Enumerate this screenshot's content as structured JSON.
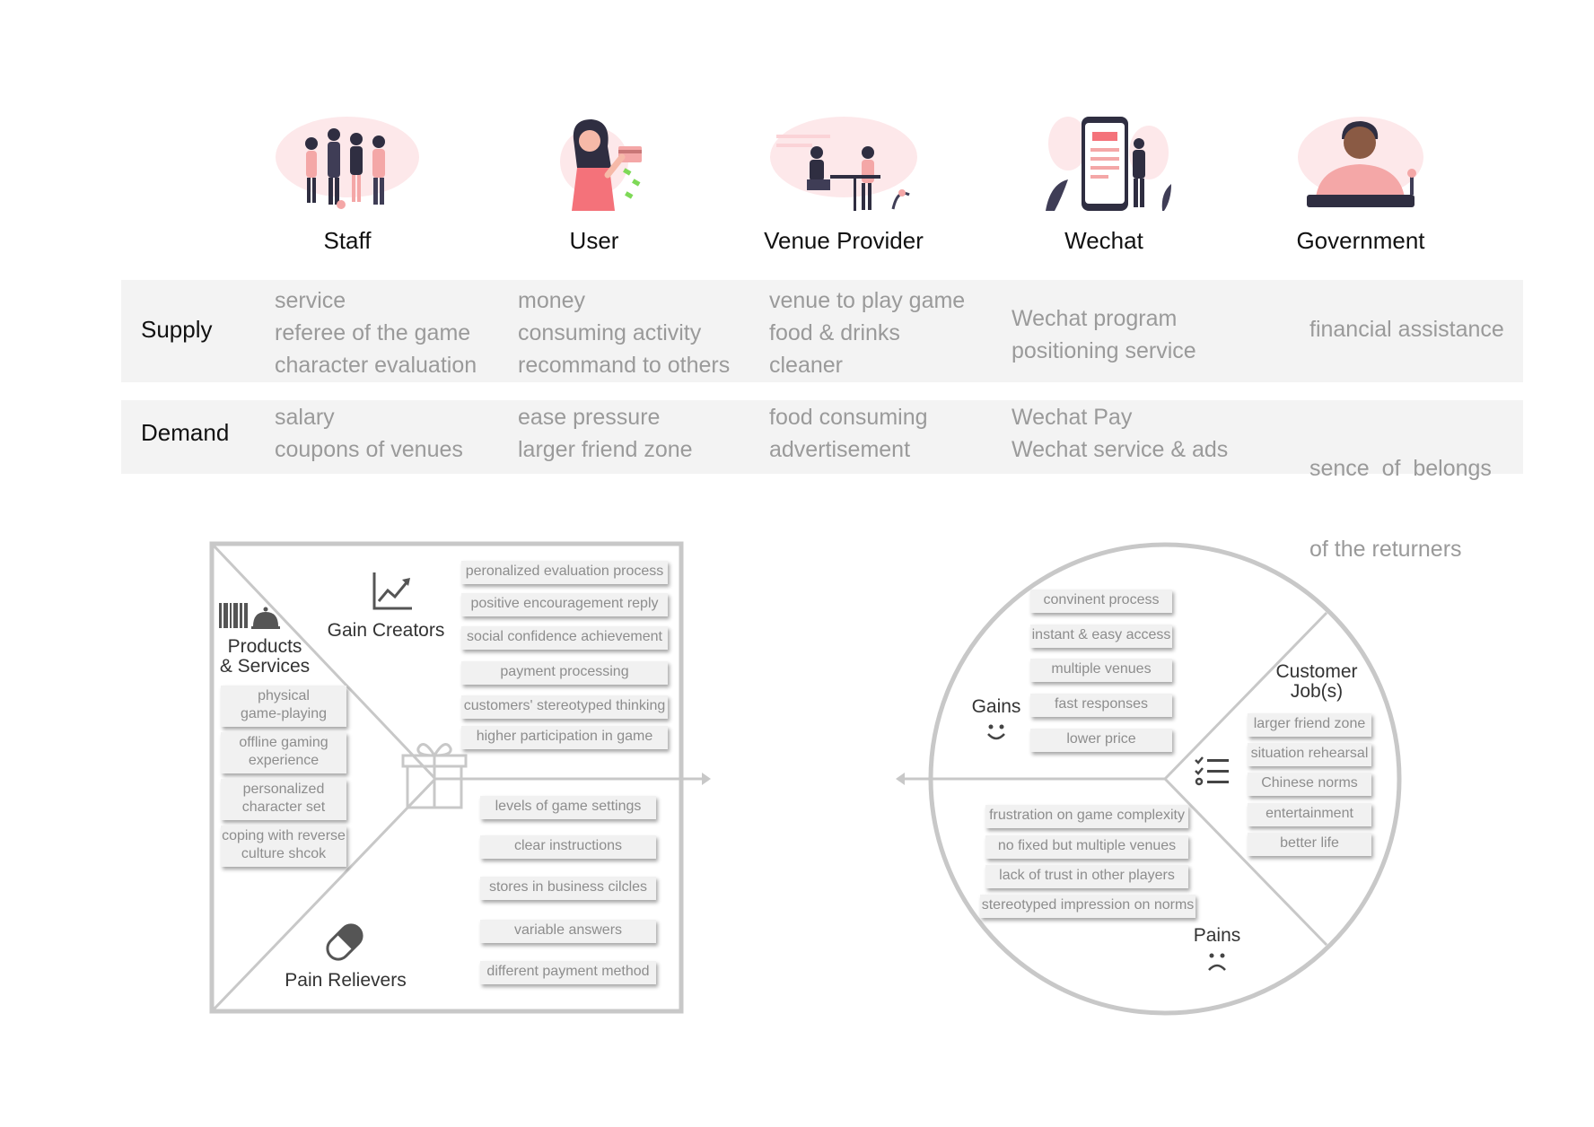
{
  "stakeholders": [
    {
      "name": "Staff",
      "icon": "staff-group-illustration"
    },
    {
      "name": "User",
      "icon": "user-woman-illustration"
    },
    {
      "name": "Venue Provider",
      "icon": "venue-cafe-illustration"
    },
    {
      "name": "Wechat",
      "icon": "phone-app-illustration"
    },
    {
      "name": "Government",
      "icon": "official-desk-illustration"
    }
  ],
  "supply": {
    "label": "Supply",
    "staff": [
      "service",
      "referee of the game",
      "character evaluation"
    ],
    "user": [
      "money",
      "consuming activity",
      "recommand to others"
    ],
    "venue": [
      "venue to play game",
      "food & drinks",
      "cleaner"
    ],
    "wechat": [
      "Wechat program",
      "positioning service"
    ],
    "government": [
      "financial assistance"
    ]
  },
  "demand": {
    "label": "Demand",
    "staff": [
      "salary",
      "coupons of venues"
    ],
    "user": [
      "ease pressure",
      "larger friend zone"
    ],
    "venue": [
      "food consuming",
      "advertisement"
    ],
    "wechat": [
      "Wechat Pay",
      "Wechat service & ads"
    ],
    "government": [
      "sence  of  belongs",
      "of the returners"
    ]
  },
  "value_map": {
    "products_label_1": "Products",
    "products_label_2": "& Services",
    "gain_creators_label": "Gain Creators",
    "pain_relievers_label": "Pain Relievers",
    "products": [
      [
        "physical",
        "game-playing"
      ],
      [
        "offline gaming",
        "experience"
      ],
      [
        "personalized",
        "character set"
      ],
      [
        "coping with reverse",
        "culture shcok"
      ]
    ],
    "gain_creators": [
      "peronalized evaluation process",
      "positive encouragement reply",
      "social confidence achievement",
      "payment processing",
      "customers' stereotyped thinking",
      "higher participation in game"
    ],
    "pain_relievers": [
      "levels of game settings",
      "clear instructions",
      "stores in business cilcles",
      "variable answers",
      "different payment method"
    ]
  },
  "customer_profile": {
    "gains_label": "Gains",
    "pains_label": "Pains",
    "jobs_label_1": "Customer",
    "jobs_label_2": "Job(s)",
    "gains": [
      "convinent process",
      "instant & easy access",
      "multiple venues",
      "fast responses",
      "lower price"
    ],
    "pains": [
      "frustration on game complexity",
      "no fixed but multiple venues",
      "lack of trust in other players",
      "stereotyped impression on norms"
    ],
    "jobs": [
      "larger friend zone",
      "situation rehearsal",
      "Chinese norms",
      "entertainment",
      "better life"
    ]
  },
  "colors": {
    "accent_pink": "#f4a7a7",
    "dark_navy": "#2f2e41",
    "band_grey": "#f3f3f3",
    "line_grey": "#c8c8c8"
  }
}
